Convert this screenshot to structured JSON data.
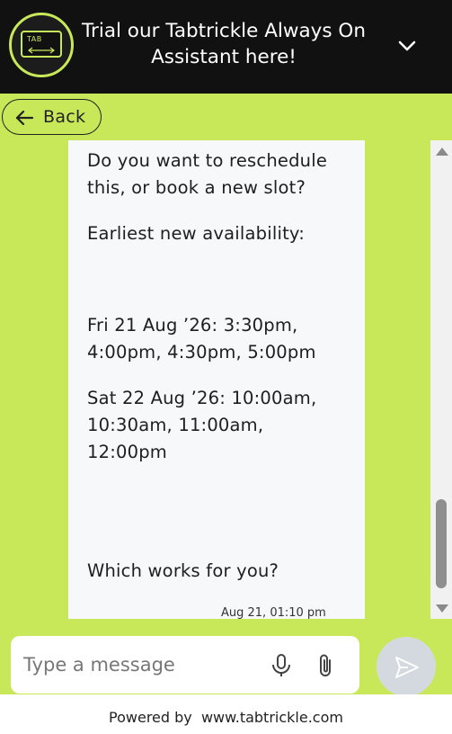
{
  "header": {
    "title": "Trial our Tabtrickle Always On Assistant here!",
    "logo_text": "TAB",
    "collapse_icon": "chevron-down-icon"
  },
  "nav": {
    "back_label": "Back",
    "back_icon": "arrow-left-icon"
  },
  "message": {
    "line1": "Do you want to reschedule this, or book a new slot?",
    "line2": "Earliest new availability:",
    "slot_fri": "Fri 21 Aug ’26: 3:30pm, 4:00pm, 4:30pm, 5:00pm",
    "slot_sat": "Sat 22 Aug ’26: 10:00am, 10:30am, 11:00am, 12:00pm",
    "question": "Which works for you?",
    "timestamp": "Aug 21, 01:10 pm"
  },
  "composer": {
    "placeholder": "Type a message",
    "value": "",
    "mic_icon": "microphone-icon",
    "attach_icon": "paperclip-icon",
    "send_icon": "send-icon"
  },
  "footer": {
    "powered_by": "Powered by  www.tabtrickle.com"
  },
  "colors": {
    "accent": "#c8e85a",
    "header_bg": "#111111",
    "bubble_bg": "#f7f8fa",
    "send_bg": "#d4d9df"
  }
}
